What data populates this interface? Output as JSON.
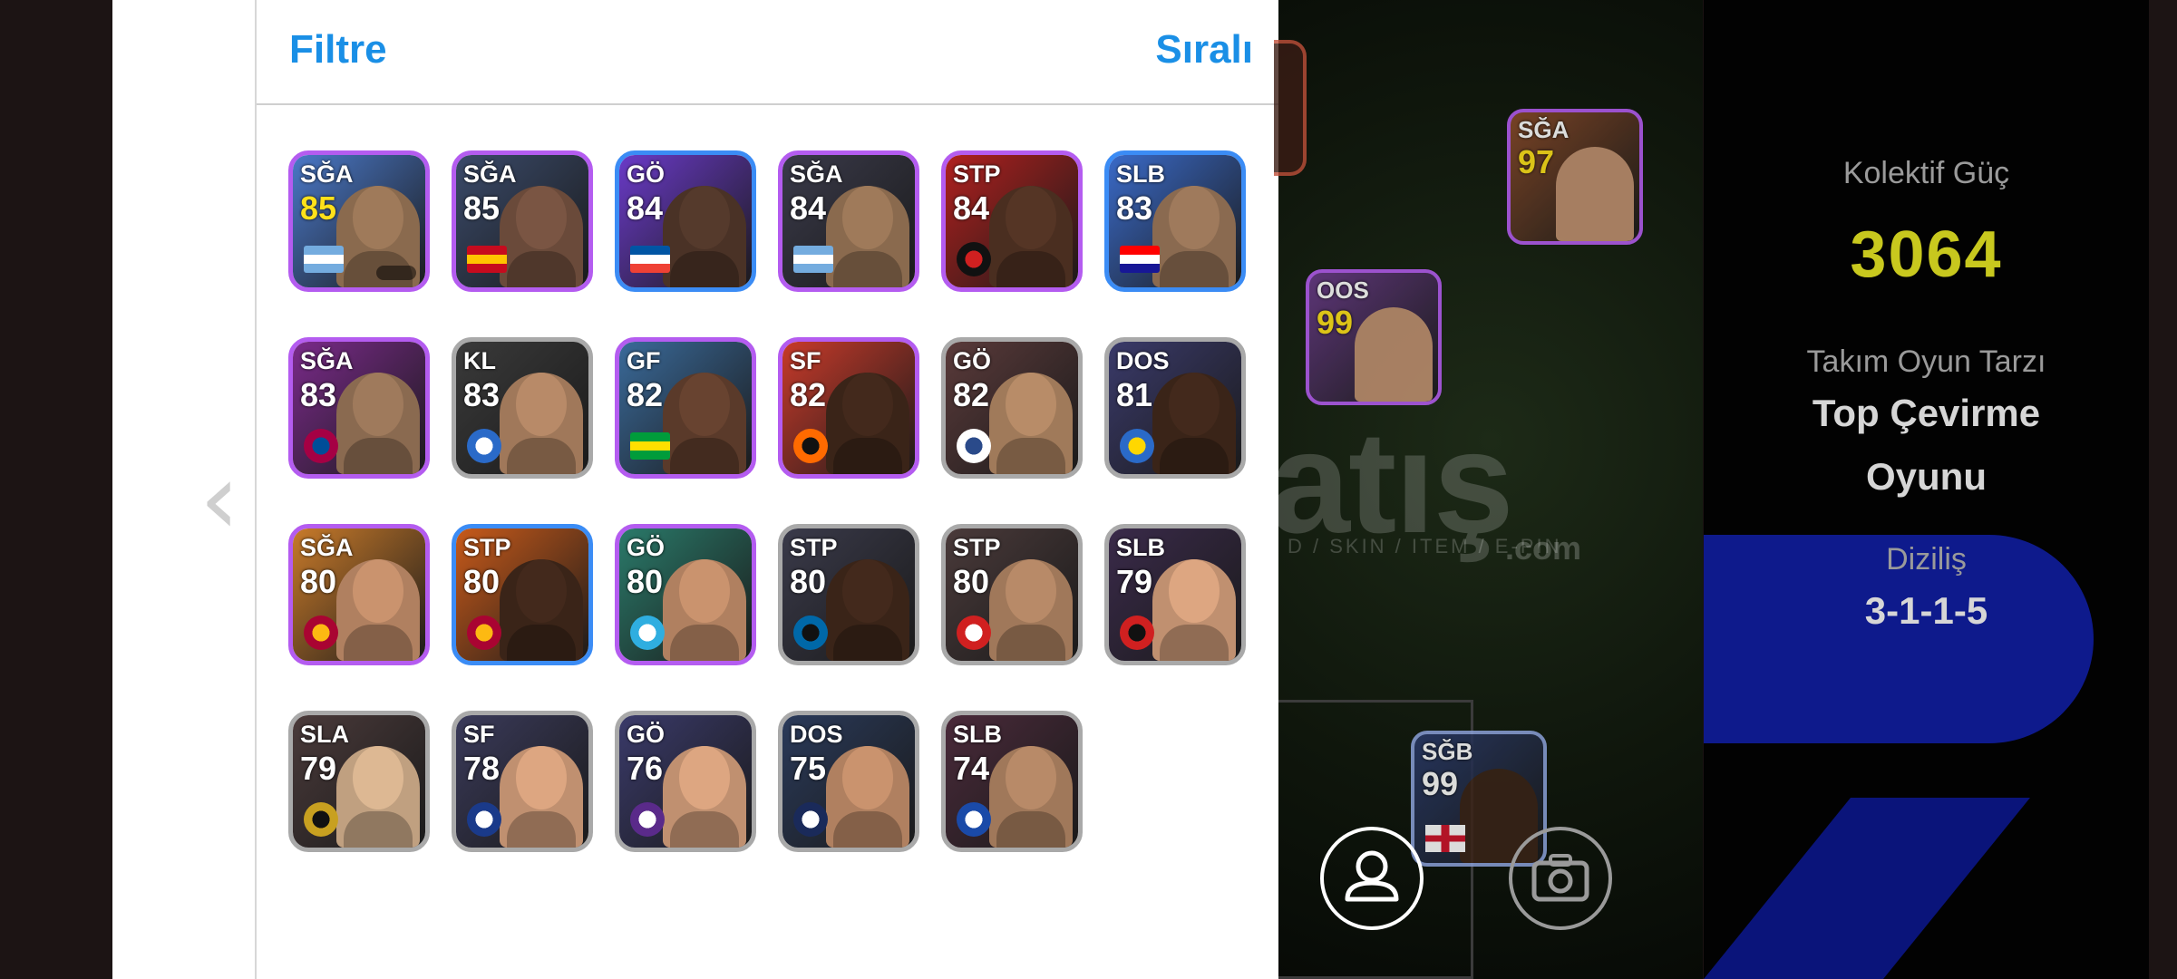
{
  "header": {
    "filter_label": "Filtre",
    "sort_label": "Sıralı"
  },
  "back_glyph": "‹",
  "players": [
    {
      "pos": "SĞA",
      "rating": "85",
      "gold": true,
      "border": "purple",
      "bg": "#4a78c8",
      "face": "#8a6a4e",
      "mark": "flag",
      "mark_colors": [
        "#74acdf",
        "#ffffff",
        "#74acdf"
      ]
    },
    {
      "pos": "SĞA",
      "rating": "85",
      "gold": false,
      "border": "purple",
      "bg": "#3a4a6a",
      "face": "#6a4a3a",
      "mark": "flag",
      "mark_colors": [
        "#c60b1e",
        "#ffc400",
        "#c60b1e"
      ]
    },
    {
      "pos": "GÖ",
      "rating": "84",
      "gold": false,
      "border": "blue",
      "bg": "#6a3ac8",
      "face": "#4a3226",
      "mark": "flag",
      "mark_colors": [
        "#0055a4",
        "#ffffff",
        "#ef4135"
      ]
    },
    {
      "pos": "SĞA",
      "rating": "84",
      "gold": false,
      "border": "purple",
      "bg": "#3a3a4a",
      "face": "#8a6a4e",
      "mark": "flag",
      "mark_colors": [
        "#74acdf",
        "#ffffff",
        "#74acdf"
      ]
    },
    {
      "pos": "STP",
      "rating": "84",
      "gold": false,
      "border": "purple",
      "bg": "#b0201e",
      "face": "#4a2e20",
      "mark": "badge",
      "mark_colors": [
        "#111111",
        "#d02020"
      ]
    },
    {
      "pos": "SLB",
      "rating": "83",
      "gold": false,
      "border": "blue",
      "bg": "#3a6ac8",
      "face": "#8a6a50",
      "mark": "flag",
      "mark_colors": [
        "#ff0000",
        "#ffffff",
        "#171796"
      ]
    },
    {
      "pos": "SĞA",
      "rating": "83",
      "gold": false,
      "border": "purple",
      "bg": "#7a2a8a",
      "face": "#8a6a50",
      "mark": "badge",
      "mark_colors": [
        "#a50044",
        "#004d98"
      ]
    },
    {
      "pos": "KL",
      "rating": "83",
      "gold": false,
      "border": "gray",
      "bg": "#3a3a3a",
      "face": "#a0785a",
      "mark": "badge",
      "mark_colors": [
        "#2a6ac8",
        "#ffffff"
      ]
    },
    {
      "pos": "GF",
      "rating": "82",
      "gold": false,
      "border": "purple",
      "bg": "#3a6a9a",
      "face": "#5a3a2a",
      "mark": "flag",
      "mark_colors": [
        "#009c3b",
        "#ffdf00",
        "#009c3b"
      ]
    },
    {
      "pos": "SF",
      "rating": "82",
      "gold": false,
      "border": "purple",
      "bg": "#c83a2a",
      "face": "#3a2418",
      "mark": "badge",
      "mark_colors": [
        "#ff6a00",
        "#111111"
      ]
    },
    {
      "pos": "GÖ",
      "rating": "82",
      "gold": false,
      "border": "gray",
      "bg": "#5a3a3a",
      "face": "#a07a5a",
      "mark": "badge",
      "mark_colors": [
        "#ffffff",
        "#2a4a8a"
      ]
    },
    {
      "pos": "DOS",
      "rating": "81",
      "gold": false,
      "border": "gray",
      "bg": "#3a3a6a",
      "face": "#3a2418",
      "mark": "badge",
      "mark_colors": [
        "#2a6ac8",
        "#ffd700"
      ]
    },
    {
      "pos": "SĞA",
      "rating": "80",
      "gold": false,
      "border": "purple",
      "bg": "#c87a2a",
      "face": "#b08060",
      "mark": "badge",
      "mark_colors": [
        "#a90432",
        "#fdb912"
      ]
    },
    {
      "pos": "STP",
      "rating": "80",
      "gold": false,
      "border": "blue",
      "bg": "#c85a1a",
      "face": "#3a2418",
      "mark": "badge",
      "mark_colors": [
        "#a90432",
        "#fdb912"
      ]
    },
    {
      "pos": "GÖ",
      "rating": "80",
      "gold": false,
      "border": "purple",
      "bg": "#2a7a6a",
      "face": "#b08060",
      "mark": "badge",
      "mark_colors": [
        "#2faee0",
        "#ffffff"
      ]
    },
    {
      "pos": "STP",
      "rating": "80",
      "gold": false,
      "border": "gray",
      "bg": "#3a3a4a",
      "face": "#3a2418",
      "mark": "badge",
      "mark_colors": [
        "#0068a8",
        "#111111"
      ]
    },
    {
      "pos": "STP",
      "rating": "80",
      "gold": false,
      "border": "gray",
      "bg": "#4a3a3a",
      "face": "#a0785a",
      "mark": "badge",
      "mark_colors": [
        "#d02020",
        "#ffffff"
      ]
    },
    {
      "pos": "SLB",
      "rating": "79",
      "gold": false,
      "border": "gray",
      "bg": "#3a2a4a",
      "face": "#c09070",
      "mark": "badge",
      "mark_colors": [
        "#d02020",
        "#111111"
      ]
    },
    {
      "pos": "SLA",
      "rating": "79",
      "gold": false,
      "border": "gray",
      "bg": "#4a3a3a",
      "face": "#c0a080",
      "mark": "badge",
      "mark_colors": [
        "#c8a020",
        "#111111"
      ]
    },
    {
      "pos": "SF",
      "rating": "78",
      "gold": false,
      "border": "gray",
      "bg": "#3a3a5a",
      "face": "#c09070",
      "mark": "badge",
      "mark_colors": [
        "#1a3a8a",
        "#ffffff"
      ]
    },
    {
      "pos": "GÖ",
      "rating": "76",
      "gold": false,
      "border": "gray",
      "bg": "#3a3a6a",
      "face": "#c09070",
      "mark": "badge",
      "mark_colors": [
        "#5a2a8a",
        "#ffffff"
      ]
    },
    {
      "pos": "DOS",
      "rating": "75",
      "gold": false,
      "border": "gray",
      "bg": "#2a3a5a",
      "face": "#b08060",
      "mark": "badge",
      "mark_colors": [
        "#1a2a5a",
        "#ffffff"
      ]
    },
    {
      "pos": "SLB",
      "rating": "74",
      "gold": false,
      "border": "gray",
      "bg": "#4a2a3a",
      "face": "#a0785a",
      "mark": "badge",
      "mark_colors": [
        "#1a4aa8",
        "#ffffff"
      ]
    }
  ],
  "pitch": {
    "watermark": "atış",
    "watermark_sub": "D / SKIN / ITEM / E-PIN",
    "watermark_com": ".com",
    "cards": [
      {
        "pos": "SĞA",
        "rating": "97",
        "gold": true,
        "bg": "#8a4a2a",
        "face": "#c09070"
      },
      {
        "pos": "OOS",
        "rating": "99",
        "gold": true,
        "bg": "#6a3a8a",
        "face": "#c09070"
      },
      {
        "pos": "SĞB",
        "rating": "99",
        "gold": false,
        "bg": "#2a3a6a",
        "face": "#3a2418"
      }
    ]
  },
  "sidebar": {
    "team_power_label": "Kolektif Güç",
    "team_power_value": "3064",
    "play_style_label": "Takım Oyun Tarzı",
    "play_style_line1": "Top Çevirme",
    "play_style_line2": "Oyunu",
    "formation_label": "Diziliş",
    "formation_value": "3-1-1-5"
  }
}
